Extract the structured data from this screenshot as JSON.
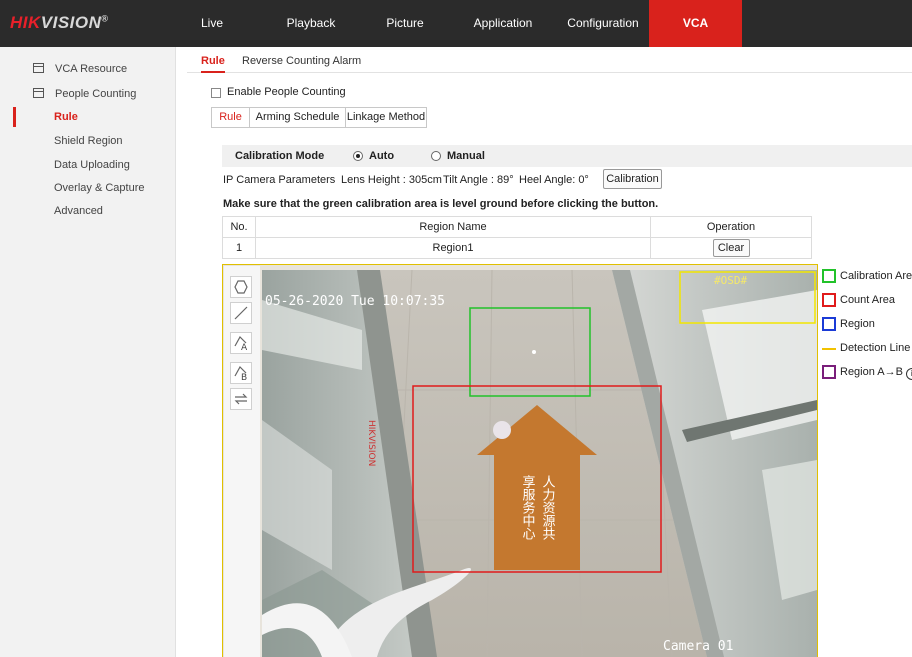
{
  "brand": {
    "logo_red": "HIK",
    "logo_rest": "VISION",
    "logo_mark": "®"
  },
  "topnav": [
    {
      "label": "Live View"
    },
    {
      "label": "Playback"
    },
    {
      "label": "Picture"
    },
    {
      "label": "Application"
    },
    {
      "label": "Configuration"
    },
    {
      "label": "VCA",
      "active": true
    }
  ],
  "sidebar": {
    "items": [
      {
        "label": "VCA Resource",
        "icon": "window-icon"
      },
      {
        "label": "People Counting",
        "icon": "people-counting-icon"
      },
      {
        "label": "Rule",
        "active": true
      },
      {
        "label": "Shield Region"
      },
      {
        "label": "Data Uploading"
      },
      {
        "label": "Overlay & Capture"
      },
      {
        "label": "Advanced"
      }
    ]
  },
  "tabs": [
    {
      "label": "Rule",
      "active": true
    },
    {
      "label": "Reverse Counting Alarm"
    }
  ],
  "enable": {
    "label": "Enable People Counting",
    "checked": false
  },
  "steps": [
    {
      "label": "Rule",
      "active": true
    },
    {
      "label": "Arming Schedule"
    },
    {
      "label": "Linkage Method"
    }
  ],
  "calibration": {
    "mode_label": "Calibration Mode",
    "auto_label": "Auto",
    "manual_label": "Manual",
    "selected": "Auto",
    "params_label": "IP Camera Parameters",
    "lens_height": "Lens Height : 305cm",
    "tilt_angle": "Tilt Angle : 89°",
    "heel_angle": "Heel Angle: 0°",
    "button": "Calibration",
    "hint": "Make sure that the green calibration area is level ground before clicking the button."
  },
  "table": {
    "headers": [
      "No.",
      "Region Name",
      "Operation"
    ],
    "rows": [
      {
        "no": "1",
        "name": "Region1",
        "op": "Clear"
      }
    ]
  },
  "tools": [
    "polygon-icon",
    "line-icon",
    "region-a-icon",
    "region-b-icon",
    "swap-direction-icon"
  ],
  "tool_letters": {
    "a": "A",
    "b": "B"
  },
  "video": {
    "timestamp": "05-26-2020 Tue 10:07:35",
    "osd": "#OSD#",
    "camera_name": "Camera 01",
    "sign_left": "享服务中心",
    "sign_right": "人力资源共",
    "wall_brand": "HIKVISION"
  },
  "legend": [
    {
      "label": "Calibration Area",
      "color": "#22c22a"
    },
    {
      "label": "Count Area",
      "color": "#e01b1b"
    },
    {
      "label": "Region",
      "color": "#1b3bd6"
    },
    {
      "label": "Detection Line",
      "color": "#f2c200"
    },
    {
      "label": "Region A→B",
      "color": "#7a1e7a"
    }
  ]
}
